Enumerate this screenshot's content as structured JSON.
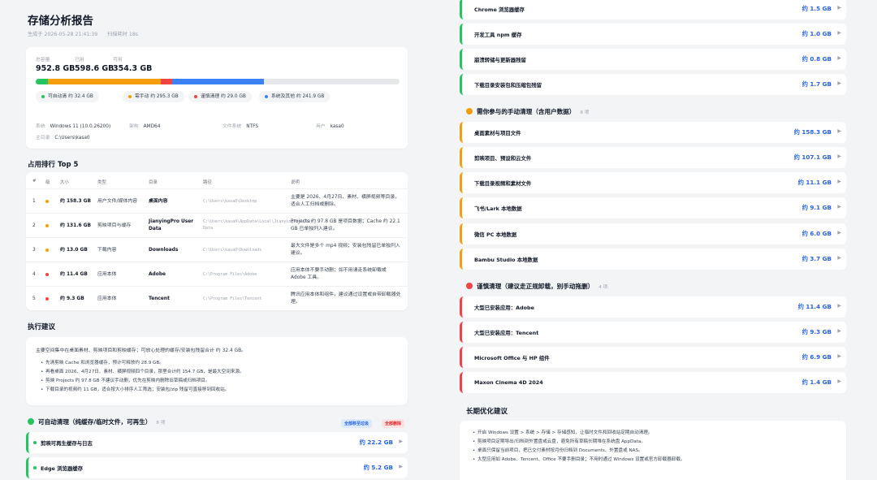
{
  "header": {
    "title": "存储分析报告",
    "generated": "生成于 2026-05-28 21:41:39",
    "scan_time": "扫描耗时 18s"
  },
  "summary": {
    "total_label": "总容量",
    "total_value": "952.8 GB",
    "used_label": "已用",
    "used_value": "598.6 GB",
    "free_label": "可用",
    "free_value": "354.3 GB",
    "bar": [
      {
        "name": "可自动清",
        "fraction": 0.034,
        "color": "#22c55e"
      },
      {
        "name": "需手动",
        "fraction": 0.31,
        "color": "#f59e0b"
      },
      {
        "name": "谨慎清理",
        "fraction": 0.03,
        "color": "#ef4444"
      },
      {
        "name": "系统及其他",
        "fraction": 0.254,
        "color": "#3b82f6"
      }
    ],
    "legend": [
      {
        "label": "可自动清 约 32.4 GB",
        "color": "#22c55e"
      },
      {
        "label": "需手动 约 295.3 GB",
        "color": "#f59e0b"
      },
      {
        "label": "谨慎清理 约 29.0 GB",
        "color": "#ef4444"
      },
      {
        "label": "系统及其他 约 241.9 GB",
        "color": "#3b82f6"
      }
    ],
    "system": {
      "os_k": "系统",
      "os_v": "Windows 11 (10.0.26200)",
      "arch_k": "架构",
      "arch_v": "AMD64",
      "fs_k": "文件系统",
      "fs_v": "NTFS",
      "user_k": "用户",
      "user_v": "kasa0",
      "home_k": "主目录",
      "home_v": "C:\\Users\\kasa0"
    }
  },
  "ranking": {
    "title": "占用排行 Top 5",
    "headers": [
      "#",
      "级",
      "大小",
      "类型",
      "目录",
      "路径",
      "说明"
    ],
    "rows": [
      {
        "n": "1",
        "color": "#f59e0b",
        "size": "约 158.3 GB",
        "type": "用户文件/媒体内容",
        "dir": "桌面内容",
        "path": "C:\\Users\\kasa0\\Desktop",
        "desc": "主要是 2026、4月27日、素材、横屏视频等目录，适合人工归档或删除。"
      },
      {
        "n": "2",
        "color": "#f59e0b",
        "size": "约 131.6 GB",
        "type": "剪映项目与缓存",
        "dir": "JianyingPro User Data",
        "path": "C:\\Users\\kasa0\\AppData\\Local\\JianyingPro\\User Data",
        "desc": "Projects 约 97.8 GB 是项目数据；Cache 约 22.1 GB 已单独列入建议。"
      },
      {
        "n": "3",
        "color": "#f59e0b",
        "size": "约 13.0 GB",
        "type": "下载内容",
        "dir": "Downloads",
        "path": "C:\\Users\\kasa0\\Downloads",
        "desc": "最大文件是多个 mp4 视频；安装包残留已单独列入建议。"
      },
      {
        "n": "4",
        "color": "#ef4444",
        "size": "约 11.4 GB",
        "type": "应用本体",
        "dir": "Adobe",
        "path": "C:\\Program Files\\Adobe",
        "desc": "应用本体不要手动删；如不用请走系统卸载或 Adobe 工具。"
      },
      {
        "n": "5",
        "color": "#ef4444",
        "size": "约 9.3 GB",
        "type": "应用本体",
        "dir": "Tencent",
        "path": "C:\\Program Files\\Tencent",
        "desc": "腾讯应用本体和组件，建议通过设置或自带卸载器处理。"
      }
    ]
  },
  "advice": {
    "title": "执行建议",
    "intro": "主要空间集中在桌面素材、剪映项目和剪映缓存；可放心处理的缓存/安装包残留合计 约 32.4 GB。",
    "items": [
      "先清剪映 Cache 和浏览器缓存，预计可释放约 28.9 GB。",
      "再看桌面 2026、4月27日、素材、横屏视频四个目录，那里合计约 154.7 GB，是最大空间来源。",
      "剪映 Projects 约 97.8 GB 不建议手动删，优先在剪映内删除旧草稿或归档项目。",
      "下载目录的视频约 11 GB，适合按大小排序人工筛选；安装包/zip 残留可直接移到回收站。"
    ]
  },
  "auto_section": {
    "title": "可自动清理（纯缓存/临时文件，可再生）",
    "count": "6 项",
    "select_all": "全部移至垃圾",
    "delete_all": "全部删除",
    "items": [
      {
        "name": "剪映可再生缓存与日志",
        "size": "约 22.2 GB"
      },
      {
        "name": "Edge 浏览器缓存",
        "size": "约 5.2 GB"
      }
    ]
  },
  "right_top_items": [
    {
      "name": "Chrome 浏览器缓存",
      "size": "约 1.5 GB"
    },
    {
      "name": "开发工具 npm 缓存",
      "size": "约 1.0 GB"
    },
    {
      "name": "崩溃转储与更新器残留",
      "size": "约 0.8 GB"
    },
    {
      "name": "下载目录安装包和压缩包残留",
      "size": "约 1.7 GB"
    }
  ],
  "manual_section": {
    "title": "需你参与的手动清理（含用户数据）",
    "count": "6 项",
    "items": [
      {
        "name": "桌面素材与项目文件",
        "size": "约 158.3 GB"
      },
      {
        "name": "剪映项目、预设和云文件",
        "size": "约 107.1 GB"
      },
      {
        "name": "下载目录视频和素材文件",
        "size": "约 11.1 GB"
      },
      {
        "name": "飞书/Lark 本地数据",
        "size": "约 9.1 GB"
      },
      {
        "name": "微信 PC 本地数据",
        "size": "约 6.0 GB"
      },
      {
        "name": "Bambu Studio 本地数据",
        "size": "约 3.7 GB"
      }
    ]
  },
  "caution_section": {
    "title": "谨慎清理（建议走正规卸载，别手动拖删）",
    "count": "4 项",
    "items": [
      {
        "name": "大型已安装应用：Adobe",
        "size": "约 11.4 GB"
      },
      {
        "name": "大型已安装应用：Tencent",
        "size": "约 9.3 GB"
      },
      {
        "name": "Microsoft Office 与 HP 组件",
        "size": "约 6.9 GB"
      },
      {
        "name": "Maxon Cinema 4D 2024",
        "size": "约 1.4 GB"
      }
    ]
  },
  "longterm": {
    "title": "长期优化建议",
    "items": [
      "开启 Windows 设置 > 系统 > 存储 > 存储感知，让临时文件和回收站定期自动清理。",
      "剪映项目定期导出/归档到外置盘或云盘，避免所有草稿长期堆在系统盘 AppData。",
      "桌面只保留当前项目，把已交付素材按月份归档到 Documents、外置盘或 NAS。",
      "大型应用如 Adobe、Tencent、Office 不要手删目录；不用时通过 Windows 设置或官方卸载器卸载。"
    ]
  },
  "colors": {
    "auto": "#22c55e",
    "manual": "#f59e0b",
    "caution": "#ef4444",
    "system": "#3b82f6",
    "size_text": "#2563eb"
  }
}
